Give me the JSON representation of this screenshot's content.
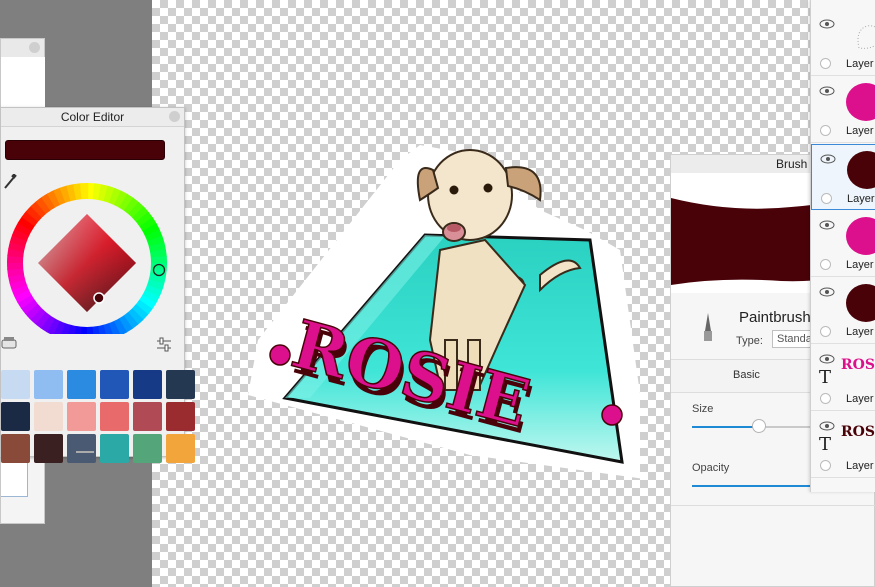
{
  "app": {
    "colors": {
      "current_color": "#4a0209",
      "accent": "#1e8ad6"
    }
  },
  "color_editor": {
    "title": "Color Editor",
    "icons": [
      "eyedropper-icon",
      "close-icon",
      "brush-tool-icon",
      "sliders-icon"
    ],
    "palette": [
      [
        "#c6dbf2",
        "#8fbdf2",
        "#2a8be0",
        "#2157b7",
        "#163a86",
        "#243852"
      ],
      [
        "#1a2a44",
        "#f2dcd2",
        "#f29a98",
        "#e96a6a",
        "#b04a55",
        "#9a2c30"
      ],
      [
        "#8a4a3a",
        "#3a2020",
        "#4a5a72",
        "#2aa9a6",
        "#55a57a",
        "#f2a53a"
      ]
    ]
  },
  "canvas": {
    "sticker_text": "ROSIE"
  },
  "brush_panel": {
    "title": "Brush",
    "brush_name": "Paintbrush",
    "type_label": "Type:",
    "type_value": "Standard",
    "tab_basic": "Basic",
    "size_label": "Size",
    "size_level": 0.37,
    "opacity_label": "Opacity",
    "opacity_level": 1.0
  },
  "layers": [
    {
      "label": "Layer",
      "thumb": "sketch",
      "visible": true
    },
    {
      "label": "Layer",
      "thumb": "#dc0f8c",
      "visible": true
    },
    {
      "label": "Layer",
      "thumb": "#4a0209",
      "visible": true,
      "selected": true
    },
    {
      "label": "Layer",
      "thumb": "#dc0f8c",
      "visible": true
    },
    {
      "label": "Layer",
      "thumb": "#4a0209",
      "visible": true
    },
    {
      "label": "Layer",
      "thumb_text": "ROSIE",
      "thumb_color": "#dc0f8c",
      "text_layer": true
    },
    {
      "label": "Layer",
      "thumb_text": "ROSIE",
      "thumb_color": "#4a0209",
      "text_layer": true
    }
  ]
}
